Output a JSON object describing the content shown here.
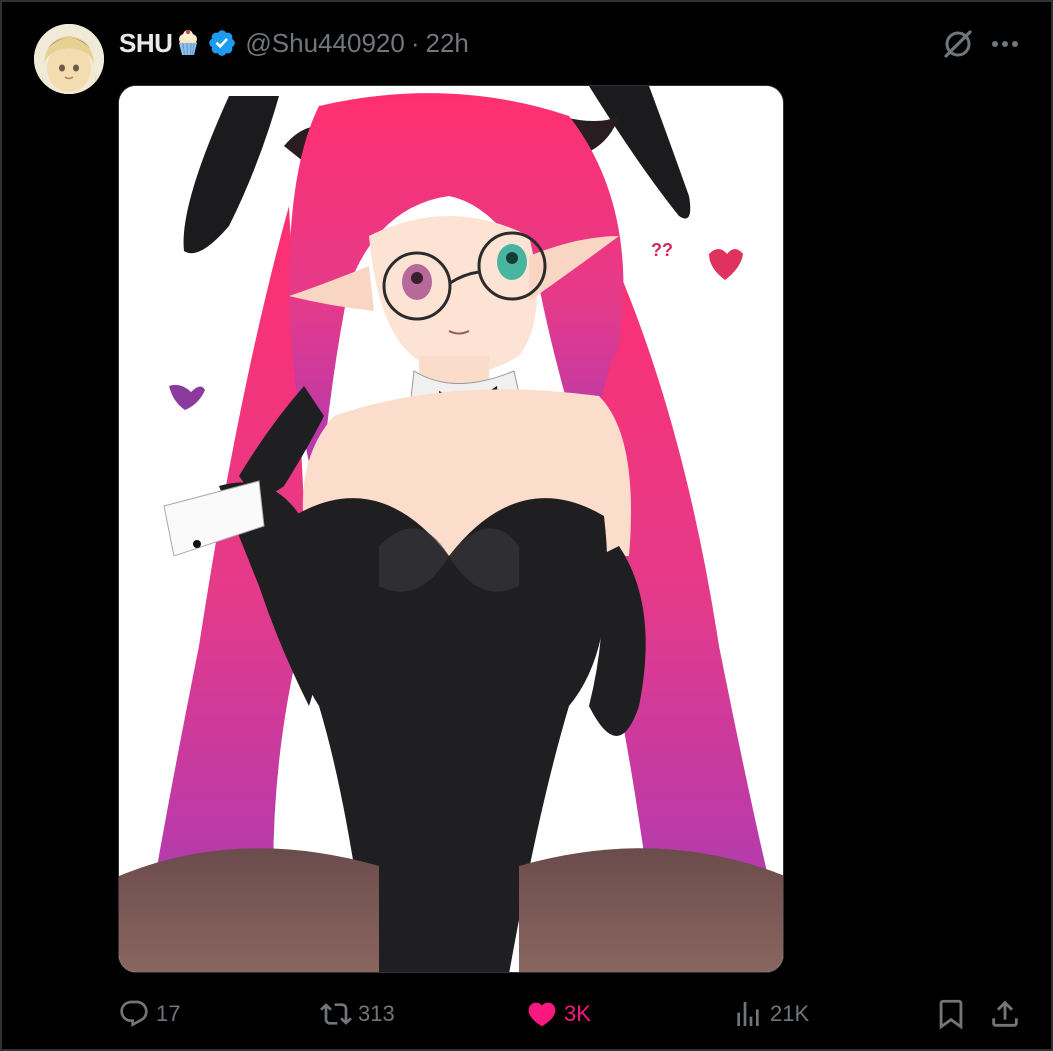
{
  "tweet": {
    "author": {
      "display_name": "SHU",
      "handle": "@Shu440920",
      "time": "22h",
      "separator": "·",
      "avatar_icon": "avatar-image",
      "emoji_icon": "cupcake-emoji",
      "verified_icon": "verified-badge-icon"
    },
    "media": {
      "icon": "anime-girl-illustration"
    },
    "actions": {
      "reply_count": "17",
      "repost_count": "313",
      "like_count": "3K",
      "views_count": "21K",
      "bookmark_icon": "bookmark-icon",
      "share_icon": "share-icon"
    },
    "colors": {
      "background": "#000000",
      "text_primary": "#e7e9ea",
      "text_secondary": "#71767b",
      "like_active": "#f91880",
      "verified": "#1d9bf0"
    }
  }
}
